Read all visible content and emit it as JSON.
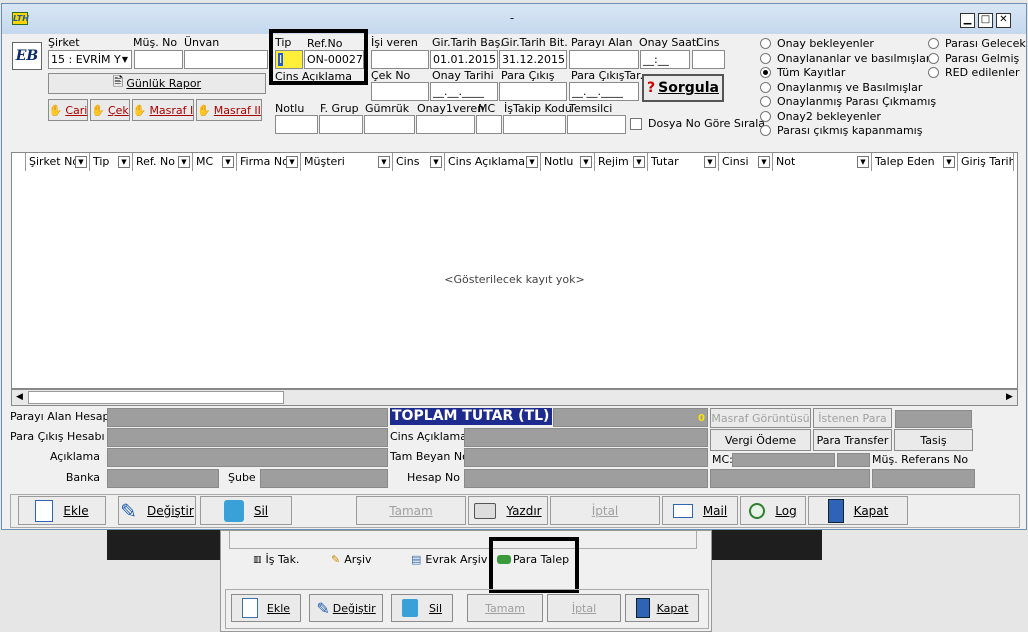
{
  "window": {
    "title": "-",
    "app_icon": "LTH"
  },
  "left": {
    "logo": "EB",
    "sirket_label": "Şirket",
    "mus_no_label": "Müş. No",
    "unvan_label": "Ünvan",
    "sirket_value": "15 : EVRİM Y",
    "gunluk_rapor": "Günlük Rapor",
    "cari": "Cari",
    "cek": "Çek",
    "masraf1": "Masraf I",
    "masraf2": "Masraf II"
  },
  "filters": {
    "tip_label": "Tip",
    "refno_label": "Ref.No",
    "tip_value": "I",
    "refno_value": "ON-00027",
    "cins_aciklama_label": "Cins Açıklama",
    "isi_veren_label": "İşi veren",
    "gir_bas_label": "Gir.Tarih Baş.",
    "gir_bit_label": "Gir.Tarih Bit.",
    "gir_bas_value": "01.01.2015",
    "gir_bit_value": "31.12.2015",
    "parayi_alan_label": "Parayı Alan",
    "onay_saati_label": "Onay Saati",
    "cins_label": "Cins",
    "onay_saati_value": "__:__",
    "cek_no_label": "Çek No",
    "onay_tarihi_label": "Onay Tarihi",
    "para_cikis_label": "Para Çıkış",
    "para_cikis_tar_label": "Para ÇıkışTar.",
    "onay_tarihi_value": "__.__.____",
    "para_cikis_tar_value": "__.__.____",
    "sorgula": "Sorgula",
    "notlu_label": "Notlu",
    "fgrup_label": "F. Grup",
    "gumruk_label": "Gümrük",
    "onay1_label": "Onay1veren",
    "mc_label": "MC",
    "istakip_label": "İşTakip Kodu",
    "temsilci_label": "Temsilci",
    "dosya_no_label": "Dosya No Göre Sırala"
  },
  "radios": {
    "col1": [
      "Onay bekleyenler",
      "Onaylananlar ve basılmışlar",
      "Tüm Kayıtlar",
      "Onaylanmış ve Basılmışlar",
      "Onaylanmış Parası Çıkmamış",
      "Onay2 bekleyenler",
      "Parası çıkmış kapanmamış"
    ],
    "col2": [
      "Parası Gelecek",
      "Parası Gelmiş",
      "RED edilenler"
    ],
    "selected": "Tüm Kayıtlar"
  },
  "table": {
    "columns": [
      "Şirket No",
      "Tip",
      "Ref. No",
      "MC",
      "Firma No",
      "Müşteri",
      "Cins",
      "Cins Açıklama",
      "Notlu",
      "Rejim",
      "Tutar",
      "Cinsi",
      "Not",
      "Talep Eden",
      "Giriş Tarihi"
    ],
    "empty_text": "<Gösterilecek kayıt yok>"
  },
  "bottom": {
    "parayi_alan_hesap": "Parayı Alan Hesap",
    "para_cikis_hesabi": "Para Çıkış Hesabı",
    "aciklama": "Açıklama",
    "banka": "Banka",
    "sube": "Şube",
    "toplam_tutar": "TOPLAM TUTAR (TL) :",
    "toplam_value": "0",
    "cins_aciklama": "Cins Açıklama",
    "tam_beyan_no": "Tam Beyan No",
    "hesap_no": "Hesap No",
    "masraf_goruntusu": "Masraf Görüntüsü",
    "istenen_para": "İstenen Para",
    "vergi_odeme": "Vergi Ödeme",
    "para_transfer": "Para Transfer",
    "tasis": "Tasiş",
    "mc_label": "MC:",
    "mus_referans_no": "Müş. Referans No"
  },
  "footer": {
    "ekle": "Ekle",
    "degistir": "Değiştir",
    "sil": "Sil",
    "tamam": "Tamam",
    "yazdir": "Yazdır",
    "iptal": "İptal",
    "mail": "Mail",
    "log": "Log",
    "kapat": "Kapat"
  },
  "behind": {
    "is_tak": "İş Tak.",
    "arsiv": "Arşiv",
    "evrak_arsiv": "Evrak Arşiv",
    "para_talep": "Para Talep",
    "ekle": "Ekle",
    "degistir": "Değiştir",
    "sil": "Sil",
    "tamam": "Tamam",
    "iptal": "İptal",
    "kapat": "Kapat"
  }
}
